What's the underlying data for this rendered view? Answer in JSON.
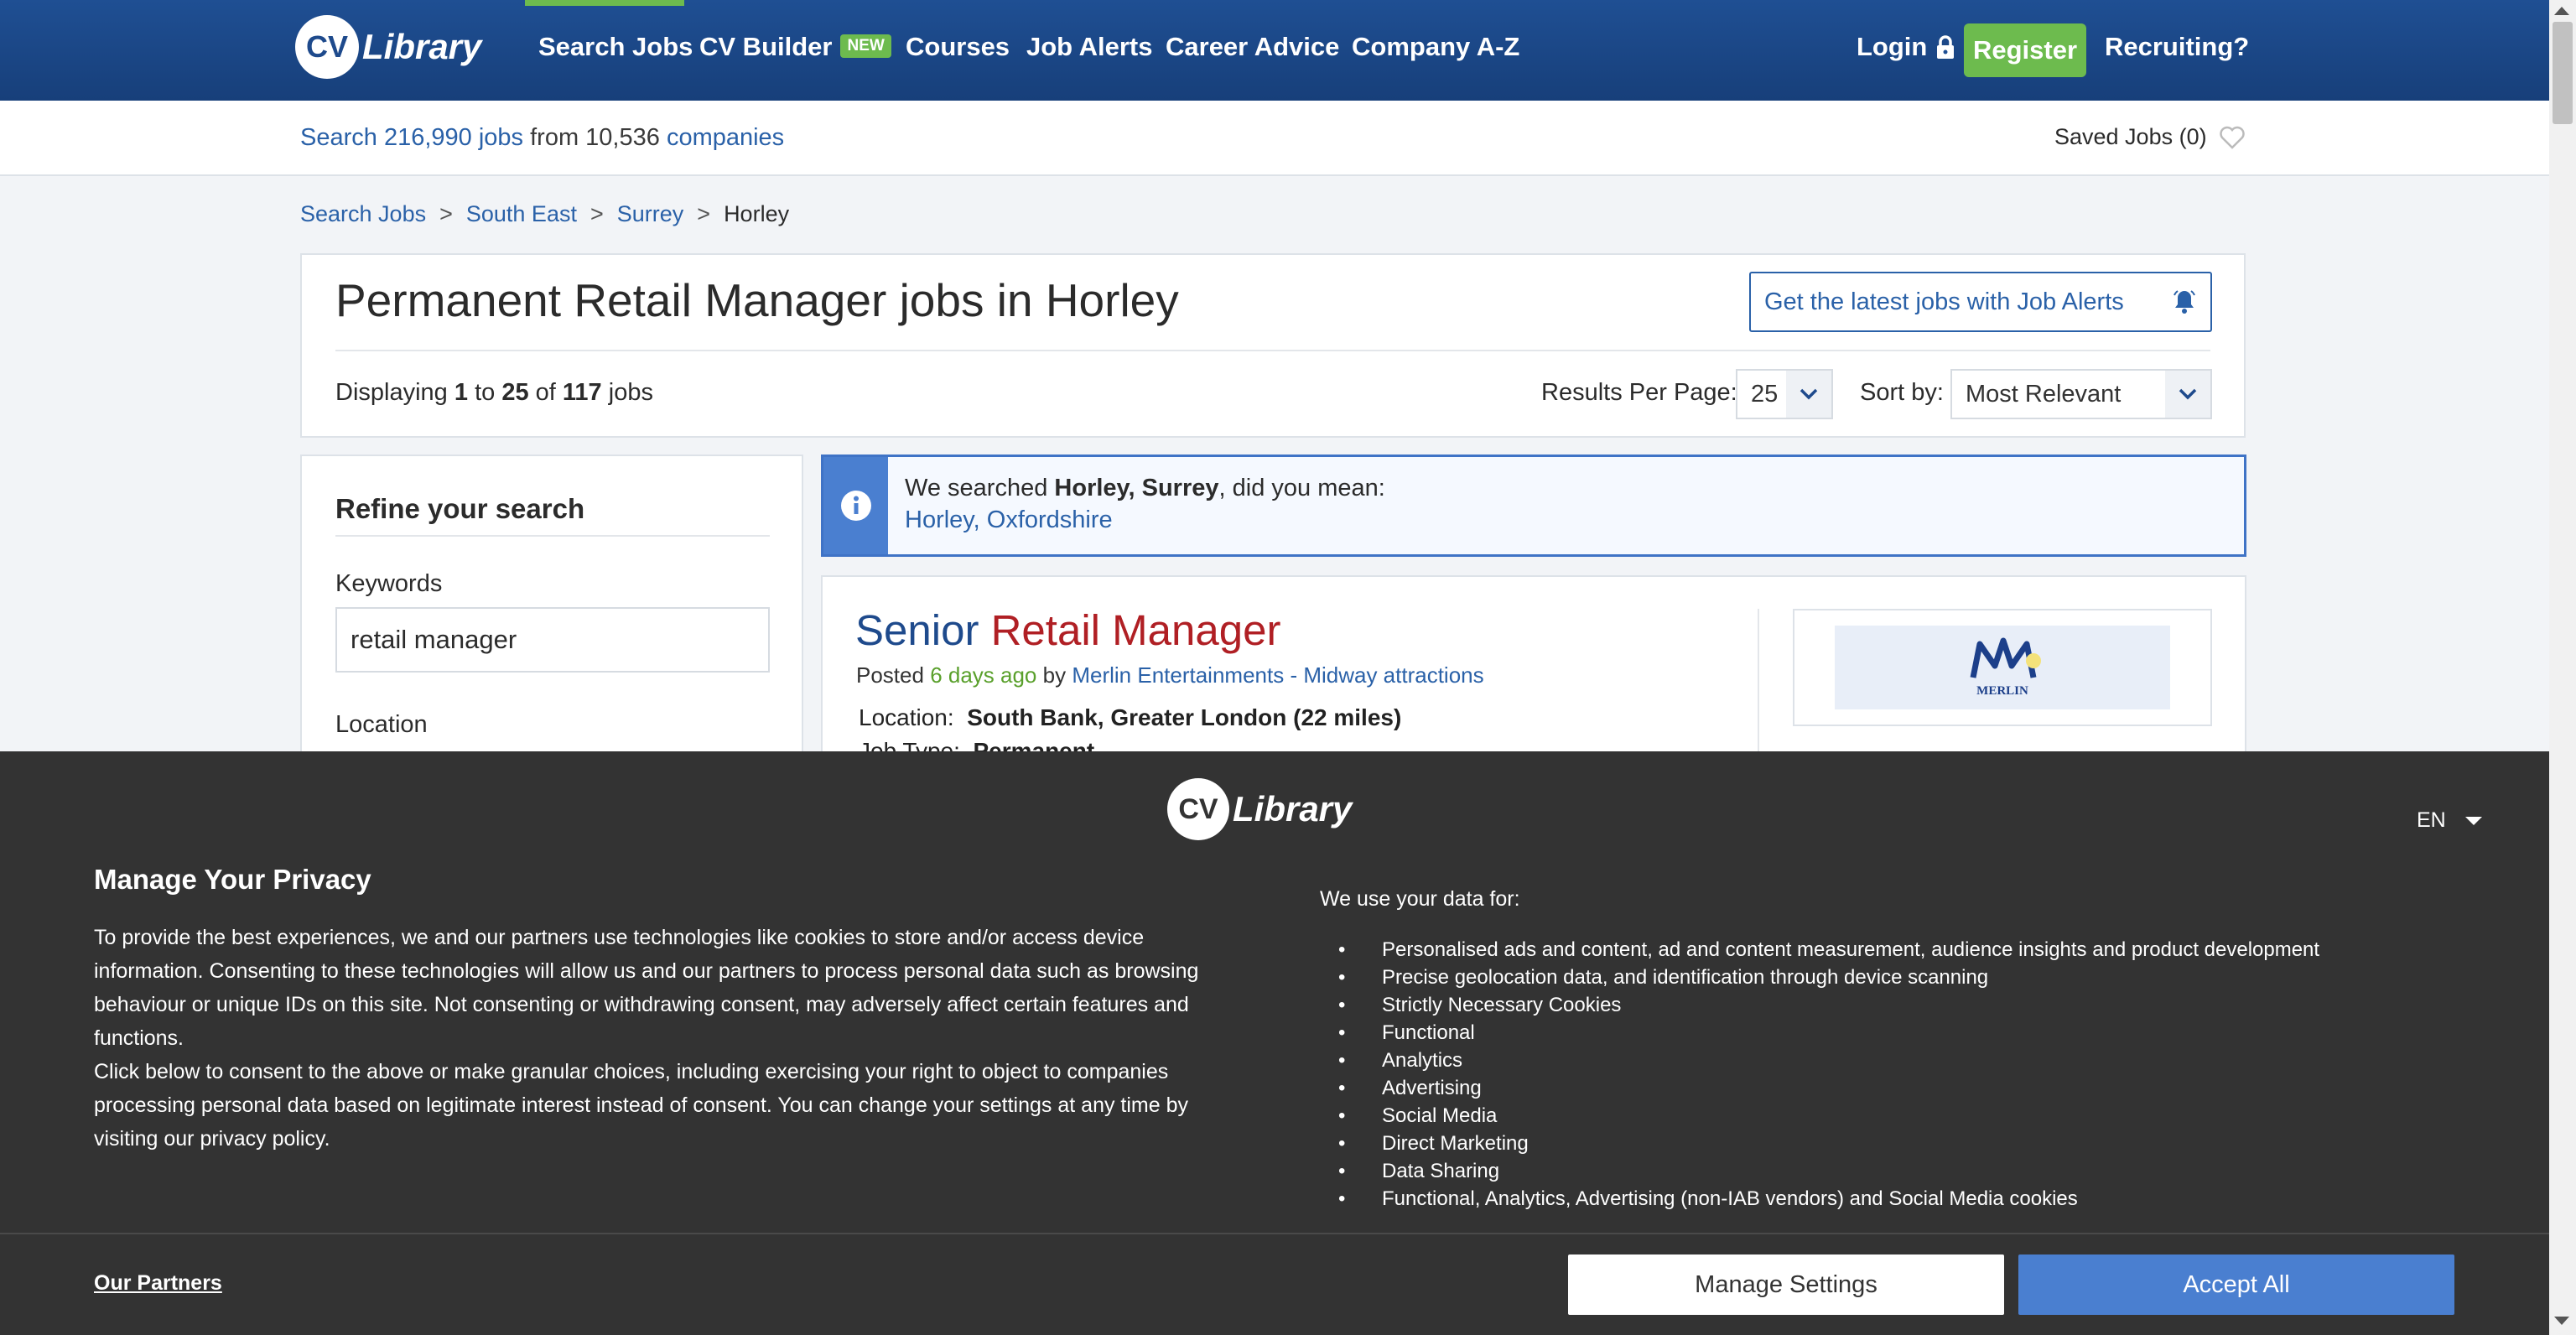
{
  "nav": {
    "logo_cv": "CV",
    "logo_library": "Library",
    "items": [
      "Search Jobs",
      "CV Builder",
      "Courses",
      "Job Alerts",
      "Career Advice",
      "Company A-Z"
    ],
    "new_badge": "NEW",
    "login": "Login",
    "register": "Register",
    "recruiting": "Recruiting?"
  },
  "subbar": {
    "search_prefix": "Search",
    "jobs_count": "216,990",
    "jobs_word": "jobs",
    "from_text": "from 10,536",
    "companies_link": "companies",
    "saved_jobs": "Saved Jobs (0)"
  },
  "breadcrumb": [
    "Search Jobs",
    "South East",
    "Surrey",
    "Horley"
  ],
  "header": {
    "title": "Permanent Retail Manager jobs in Horley",
    "alerts_button": "Get the latest jobs with Job Alerts",
    "display_prefix": "Displaying",
    "display_from": "1",
    "display_to_word": "to",
    "display_to": "25",
    "display_of_word": "of",
    "display_total": "117",
    "display_suffix": "jobs",
    "per_page_label": "Results Per Page:",
    "per_page_value": "25",
    "sort_label": "Sort by:",
    "sort_value": "Most Relevant"
  },
  "refine": {
    "title": "Refine your search",
    "keywords_label": "Keywords",
    "keywords_value": "retail manager",
    "location_label": "Location"
  },
  "didyoumean": {
    "prefix": "We searched",
    "searched": "Horley, Surrey",
    "suffix": ", did you mean:",
    "suggestion": "Horley, Oxfordshire"
  },
  "job": {
    "title_part1": "Senior",
    "title_part2": "Retail Manager",
    "posted": "Posted",
    "posted_when": "6 days ago",
    "by": "by",
    "company": "Merlin Entertainments - Midway attractions",
    "location_label": "Location:",
    "location_value": "South Bank, Greater London (22 miles)",
    "jobtype_label": "Job Type:",
    "jobtype_value": "Permanent",
    "logo_text": "MERLIN"
  },
  "privacy": {
    "language": "EN",
    "title": "Manage Your Privacy",
    "paragraph1": "To provide the best experiences, we and our partners use technologies like cookies to store and/or access device information. Consenting to these technologies will allow us and our partners to process personal data such as browsing behaviour or unique IDs on this site. Not consenting or withdrawing consent, may adversely affect certain features and functions.",
    "paragraph2": "Click below to consent to the above or make granular choices, including exercising your right to object to companies processing personal data based on legitimate interest instead of consent. You can change your settings at any time by visiting our privacy policy.",
    "data_use_title": "We use your data for:",
    "data_uses": [
      "Personalised ads and content, ad and content measurement, audience insights and product development",
      "Precise geolocation data, and identification through device scanning",
      "Strictly Necessary Cookies",
      "Functional",
      "Analytics",
      "Advertising",
      "Social Media",
      "Direct Marketing",
      "Data Sharing",
      "Functional, Analytics, Advertising (non-IAB vendors) and Social Media cookies"
    ],
    "partners_link": "Our Partners",
    "manage_button": "Manage Settings",
    "accept_button": "Accept All"
  },
  "colors": {
    "nav_blue": "#1f4f93",
    "brand_green": "#6dbb4e",
    "link_blue": "#2a61a8",
    "job_red": "#b01f24",
    "overlay_bg": "#333333",
    "accept_blue": "#4a7fd0"
  }
}
